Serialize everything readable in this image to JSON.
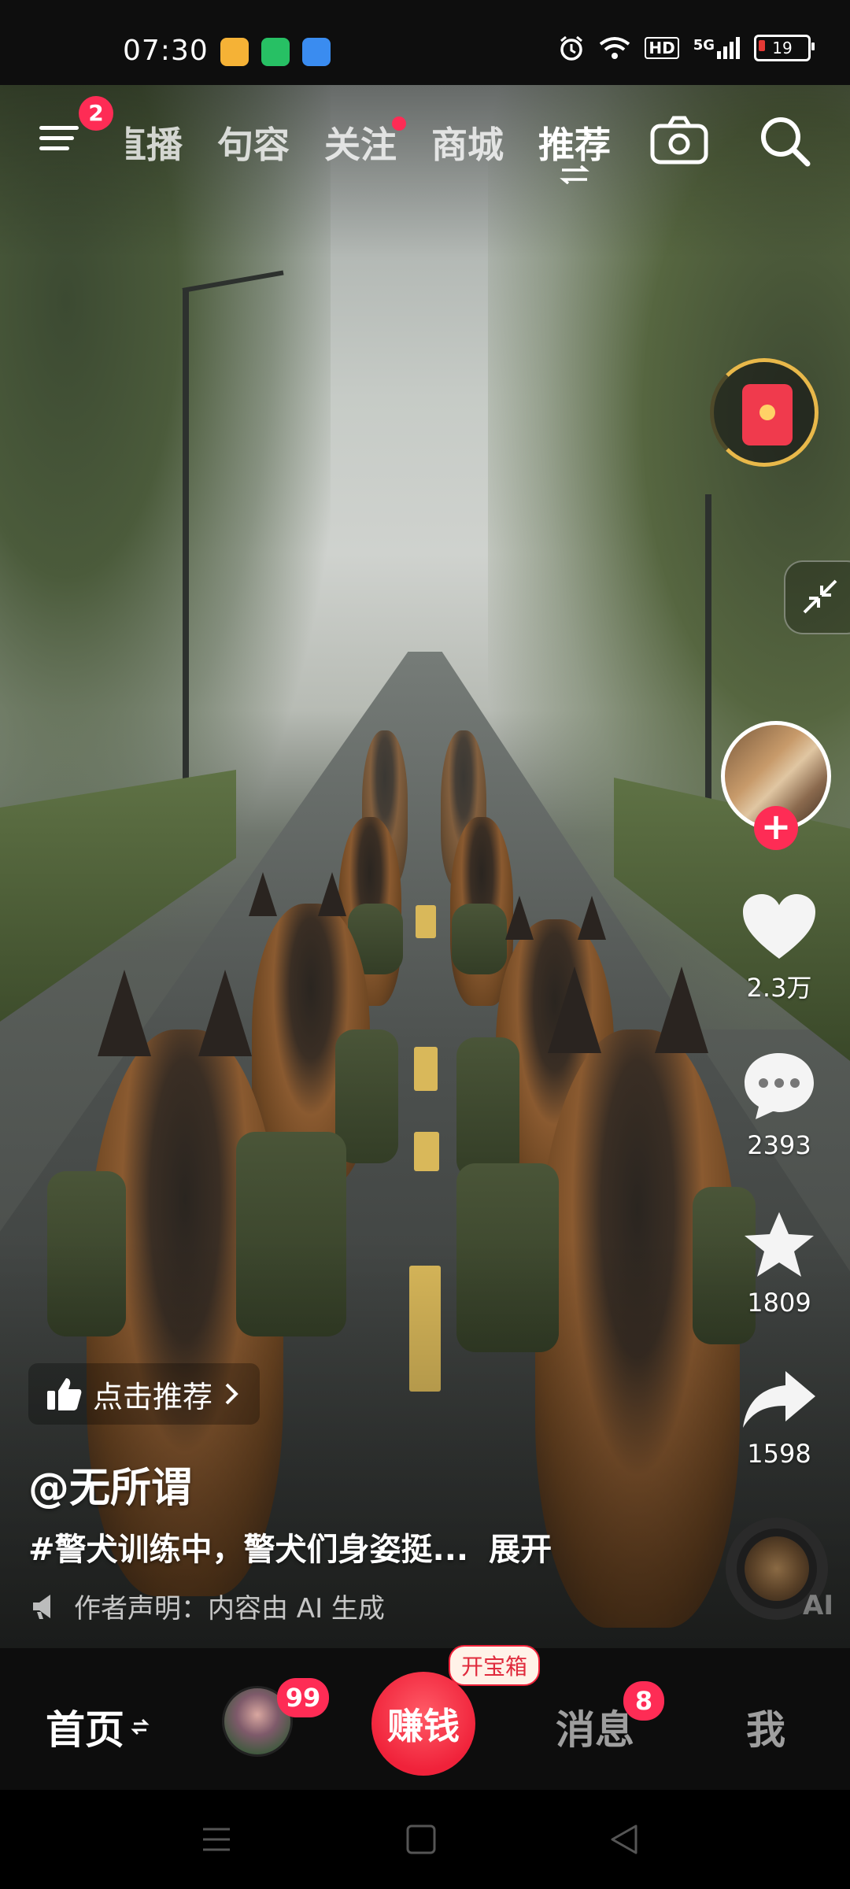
{
  "status_bar": {
    "time": "07:30",
    "battery": "19",
    "network": "5G",
    "hd": "HD",
    "app_icons": [
      {
        "name": "weibo-icon",
        "color": "#f5b236"
      },
      {
        "name": "battery-app-icon",
        "color": "#27c064"
      },
      {
        "name": "weather-icon",
        "color": "#3a8cf0"
      }
    ]
  },
  "top_nav": {
    "menu_badge": "2",
    "tabs": [
      {
        "label": "直播",
        "active": false
      },
      {
        "label": "句容",
        "active": false
      },
      {
        "label": "关注",
        "active": false,
        "dot": true
      },
      {
        "label": "商城",
        "active": false
      },
      {
        "label": "推荐",
        "active": true
      }
    ]
  },
  "video": {
    "recommend_label": "点击推荐",
    "author": "@无所谓",
    "description": "#警犬训练中，警犬们身姿挺...",
    "expand_label": "展开",
    "declaration": "作者声明：内容由 AI 生成",
    "watermark": "AI"
  },
  "rail": {
    "likes": "2.3万",
    "comments": "2393",
    "favorites": "1809",
    "shares": "1598"
  },
  "bottom_nav": {
    "home": "首页",
    "friend_badge": "99",
    "earn": "赚钱",
    "earn_tag": "开宝箱",
    "messages": "消息",
    "messages_badge": "8",
    "me": "我"
  },
  "colors": {
    "accent": "#fe2c55",
    "gold_ring": "#e8b84a"
  }
}
